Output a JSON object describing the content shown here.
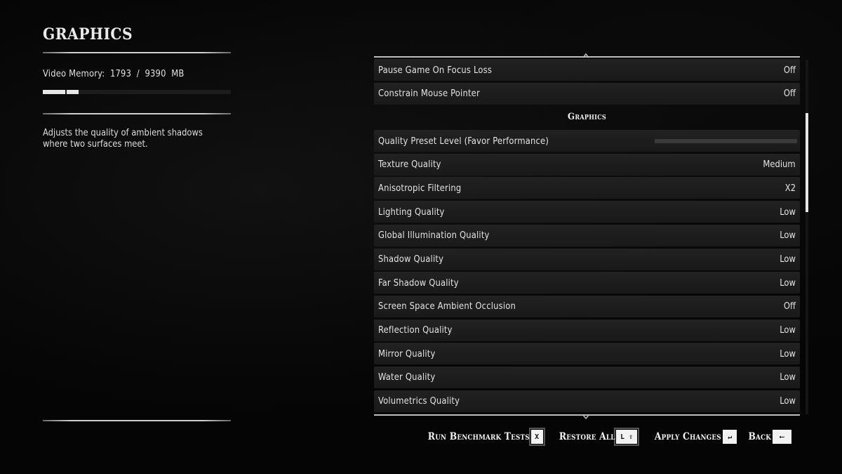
{
  "left_panel": {
    "title": "GRAPHICS",
    "video_memory": {
      "label": "Video Memory:",
      "used": "1793",
      "separator": "/",
      "total": "9390",
      "unit": "MB",
      "used_fraction": 0.191
    },
    "description": "Adjusts the quality of ambient shadows where two surfaces meet."
  },
  "settings": {
    "rows": [
      {
        "type": "option",
        "label": "Pause Game On Focus Loss",
        "value": "Off"
      },
      {
        "type": "option",
        "label": "Constrain Mouse Pointer",
        "value": "Off"
      },
      {
        "type": "header",
        "label": "Graphics"
      },
      {
        "type": "slider",
        "label": "Quality Preset Level (Favor Performance)",
        "fraction": 0.0
      },
      {
        "type": "option",
        "label": "Texture Quality",
        "value": "Medium"
      },
      {
        "type": "option",
        "label": "Anisotropic Filtering",
        "value": "X2"
      },
      {
        "type": "option",
        "label": "Lighting Quality",
        "value": "Low"
      },
      {
        "type": "option",
        "label": "Global Illumination Quality",
        "value": "Low"
      },
      {
        "type": "option",
        "label": "Shadow Quality",
        "value": "Low"
      },
      {
        "type": "option",
        "label": "Far Shadow Quality",
        "value": "Low"
      },
      {
        "type": "option",
        "label": "Screen Space Ambient Occlusion",
        "value": "Off"
      },
      {
        "type": "option",
        "label": "Reflection Quality",
        "value": "Low"
      },
      {
        "type": "option",
        "label": "Mirror Quality",
        "value": "Low"
      },
      {
        "type": "option",
        "label": "Water Quality",
        "value": "Low"
      },
      {
        "type": "option",
        "label": "Volumetrics Quality",
        "value": "Low"
      }
    ],
    "scroll": {
      "thumb_start_fraction": 0.15,
      "thumb_size_fraction": 0.28
    }
  },
  "footer": {
    "run_benchmark": {
      "label": "Run Benchmark Tests",
      "key": "X"
    },
    "restore_all": {
      "label": "Restore All",
      "key": "L ⇧"
    },
    "apply_changes": {
      "label": "Apply Changes",
      "key": "↵"
    },
    "back": {
      "label": "Back",
      "key": "⟵"
    }
  }
}
